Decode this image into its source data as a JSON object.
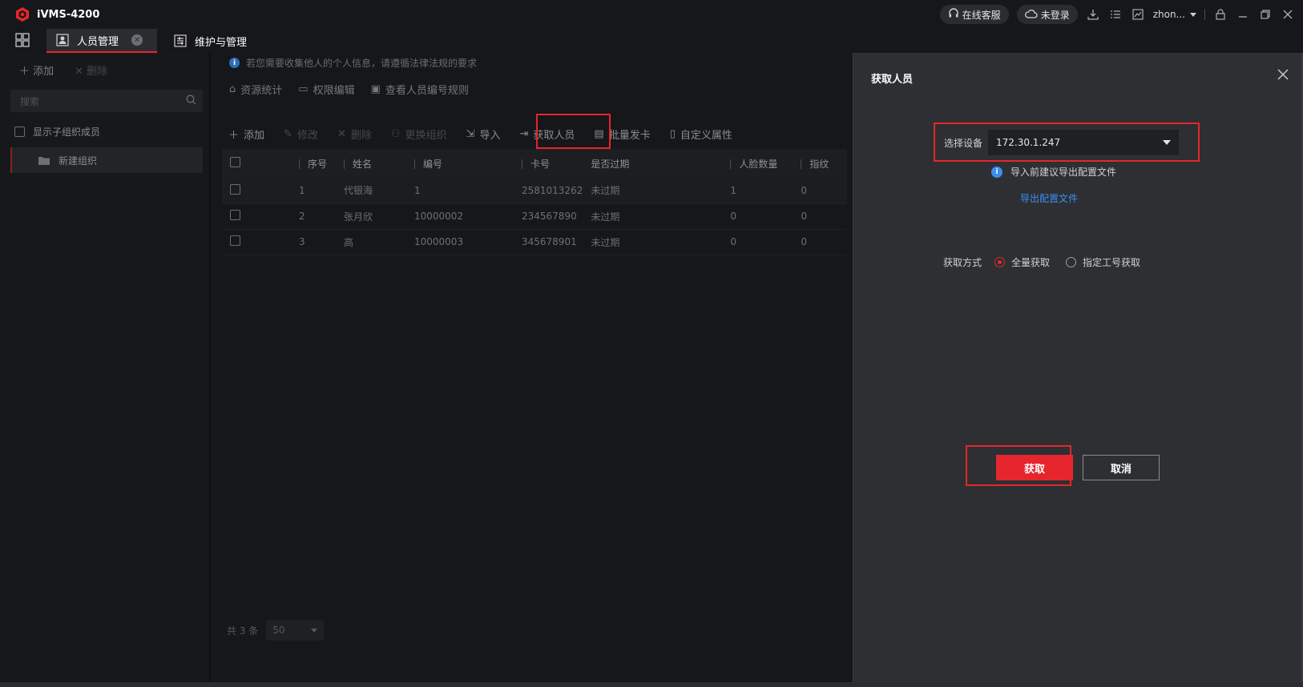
{
  "app": {
    "title": "iVMS-4200",
    "brand_color": "#e5262d"
  },
  "topbar": {
    "online_service": "在线客服",
    "not_logged_in": "未登录",
    "user": "zhon...",
    "icons": [
      "headset-icon",
      "cloud-icon",
      "download-icon",
      "list-icon",
      "chart-icon",
      "lock-icon",
      "minimize-icon",
      "restore-icon",
      "close-icon"
    ]
  },
  "tabs": [
    {
      "label": "人员管理",
      "active": true
    },
    {
      "label": "维护与管理",
      "active": false
    }
  ],
  "sidebar": {
    "add": "添加",
    "delete": "删除",
    "search_placeholder": "搜索",
    "show_sub_members": "显示子组织成员",
    "org": "新建组织"
  },
  "main": {
    "notice": "若您需要收集他人的个人信息，请遵循法律法规的要求",
    "subtools": [
      "资源统计",
      "权限编辑",
      "查看人员编号规则"
    ],
    "toolbar": {
      "add": "添加",
      "edit": "修改",
      "delete": "删除",
      "change_org": "更换组织",
      "import": "导入",
      "get_persons": "获取人员",
      "batch_card": "批量发卡",
      "custom_attr": "自定义属性"
    },
    "table": {
      "headers": [
        "序号",
        "姓名",
        "编号",
        "卡号",
        "是否过期",
        "人脸数量",
        "指纹"
      ],
      "rows": [
        [
          "1",
          "代银海",
          "1",
          "2581013262",
          "未过期",
          "1",
          "0"
        ],
        [
          "2",
          "张月欣",
          "10000002",
          "234567890",
          "未过期",
          "0",
          "0"
        ],
        [
          "3",
          "高",
          "10000003",
          "345678901",
          "未过期",
          "0",
          "0"
        ]
      ]
    },
    "pager": {
      "total": "共 3 条",
      "page_size": "50"
    }
  },
  "dialog": {
    "title": "获取人员",
    "select_device_label": "选择设备",
    "device_value": "172.30.1.247",
    "hint": "导入前建议导出配置文件",
    "export_link": "导出配置文件",
    "method_label": "获取方式",
    "method_all": "全量获取",
    "method_specific": "指定工号获取",
    "selected_method": "全量获取",
    "confirm": "获取",
    "cancel": "取消"
  }
}
